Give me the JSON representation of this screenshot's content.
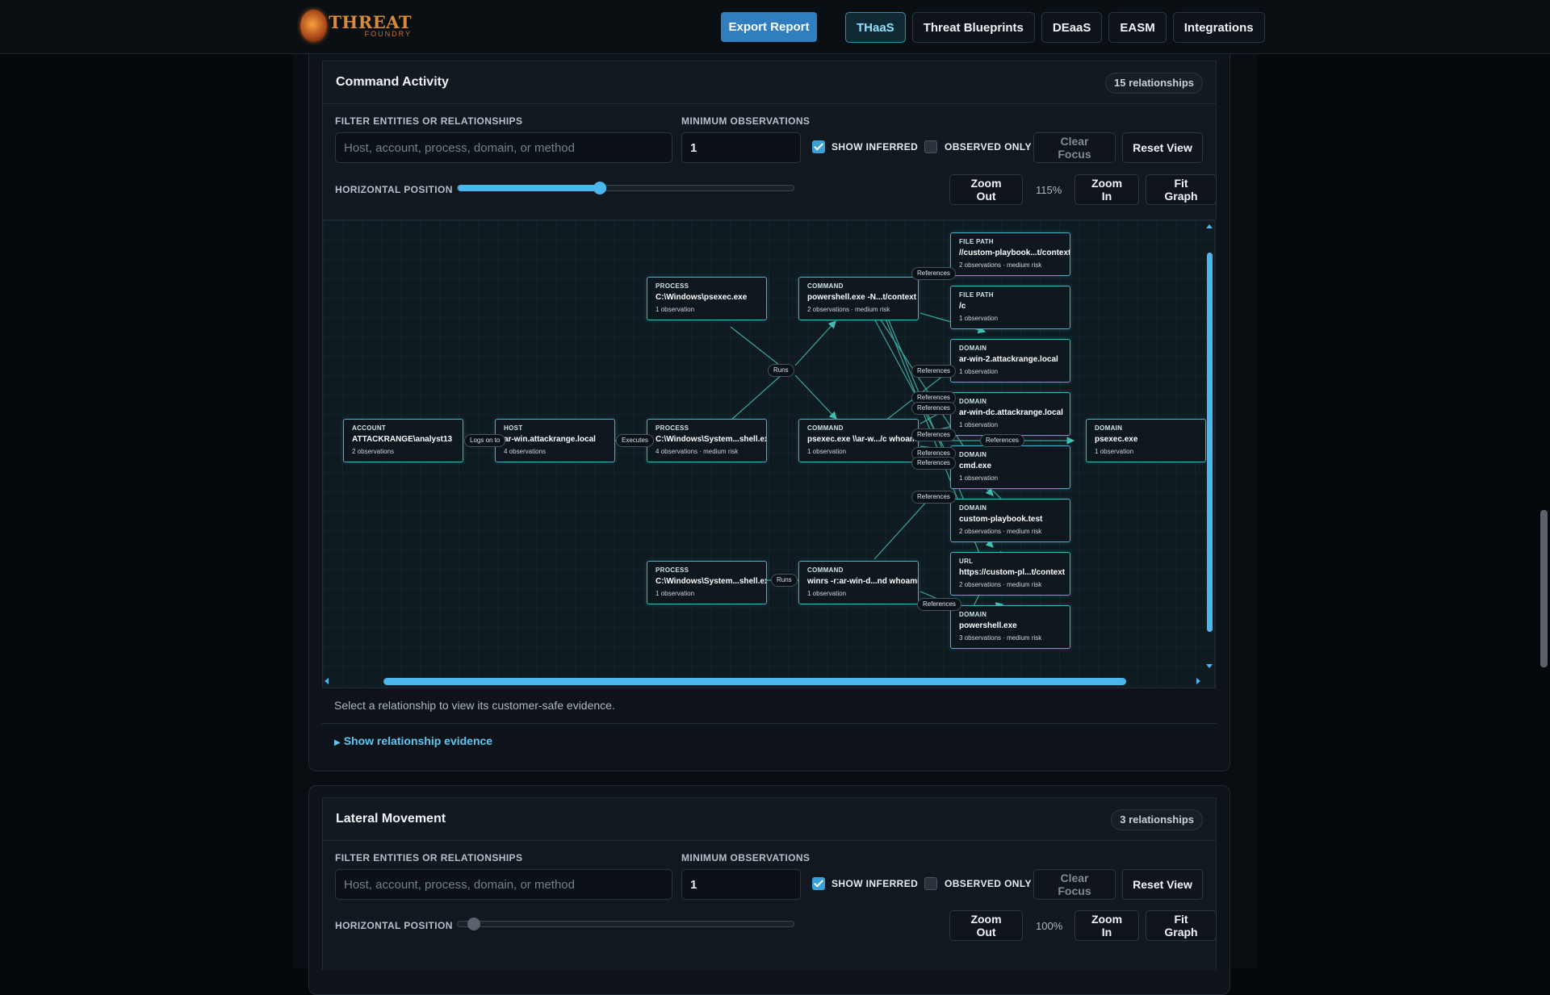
{
  "brand": {
    "line1": "THREAT",
    "line2": "FOUNDRY"
  },
  "header": {
    "export_label": "Export Report",
    "nav": [
      {
        "label": "THaaS",
        "active": true
      },
      {
        "label": "Threat Blueprints",
        "active": false
      },
      {
        "label": "DEaaS",
        "active": false
      },
      {
        "label": "EASM",
        "active": false
      },
      {
        "label": "Integrations",
        "active": false
      }
    ]
  },
  "panels": [
    {
      "title": "Command Activity",
      "badge": "15 relationships",
      "filter_label": "FILTER ENTITIES OR RELATIONSHIPS",
      "filter_placeholder": "Host, account, process, domain, or method",
      "min_obs_label": "MINIMUM OBSERVATIONS",
      "min_obs_value": "1",
      "show_inferred_label": "SHOW INFERRED",
      "show_inferred": true,
      "observed_only_label": "OBSERVED ONLY",
      "observed_only": false,
      "clear_focus": "Clear Focus",
      "reset_view": "Reset View",
      "hpos_label": "HORIZONTAL POSITION",
      "hpos_value": 0.42,
      "zoom_out": "Zoom Out",
      "zoom_pct": "115%",
      "zoom_in": "Zoom In",
      "fit_graph": "Fit Graph"
    },
    {
      "title": "Lateral Movement",
      "badge": "3 relationships",
      "filter_label": "FILTER ENTITIES OR RELATIONSHIPS",
      "filter_placeholder": "Host, account, process, domain, or method",
      "min_obs_label": "MINIMUM OBSERVATIONS",
      "min_obs_value": "1",
      "show_inferred_label": "SHOW INFERRED",
      "show_inferred": true,
      "observed_only_label": "OBSERVED ONLY",
      "observed_only": false,
      "clear_focus": "Clear Focus",
      "reset_view": "Reset View",
      "hpos_label": "HORIZONTAL POSITION",
      "hpos_value": 0.0,
      "zoom_out": "Zoom Out",
      "zoom_pct": "100%",
      "zoom_in": "Zoom In",
      "fit_graph": "Fit Graph"
    }
  ],
  "graph": {
    "nodes": [
      {
        "id": "acct",
        "type": "ACCOUNT",
        "name": "ATTACKRANGE\\analyst13",
        "meta": "2 observations"
      },
      {
        "id": "host",
        "type": "HOST",
        "name": "ar-win.attackrange.local",
        "meta": "4 observations"
      },
      {
        "id": "p1",
        "type": "PROCESS",
        "name": "C:\\Windows\\psexec.exe",
        "meta": "1 observation"
      },
      {
        "id": "p2",
        "type": "PROCESS",
        "name": "C:\\Windows\\System...shell.exe",
        "meta": "4 observations · medium risk"
      },
      {
        "id": "p3",
        "type": "PROCESS",
        "name": "C:\\Windows\\System...shell.exe",
        "meta": "1 observation"
      },
      {
        "id": "c1",
        "type": "COMMAND",
        "name": "powershell.exe -N...t/context",
        "meta": "2 observations · medium risk"
      },
      {
        "id": "c2",
        "type": "COMMAND",
        "name": "psexec.exe \\\\ar-w.../c whoami",
        "meta": "1 observation"
      },
      {
        "id": "c3",
        "type": "COMMAND",
        "name": "winrs -r:ar-win-d...nd whoami",
        "meta": "1 observation"
      },
      {
        "id": "f1",
        "type": "FILE PATH",
        "name": "//custom-playbook...t/context",
        "meta": "2 observations · medium risk"
      },
      {
        "id": "f2",
        "type": "FILE PATH",
        "name": "/c",
        "meta": "1 observation"
      },
      {
        "id": "d1",
        "type": "DOMAIN",
        "name": "ar-win-2.attackrange.local",
        "meta": "1 observation"
      },
      {
        "id": "d2",
        "type": "DOMAIN",
        "name": "ar-win-dc.attackrange.local",
        "meta": "1 observation"
      },
      {
        "id": "d3",
        "type": "DOMAIN",
        "name": "cmd.exe",
        "meta": "1 observation"
      },
      {
        "id": "d4",
        "type": "DOMAIN",
        "name": "custom-playbook.test",
        "meta": "2 observations · medium risk"
      },
      {
        "id": "u1",
        "type": "URL",
        "name": "https://custom-pl...t/context",
        "meta": "2 observations · medium risk"
      },
      {
        "id": "d5",
        "type": "DOMAIN",
        "name": "powershell.exe",
        "meta": "3 observations · medium risk"
      },
      {
        "id": "d6",
        "type": "DOMAIN",
        "name": "psexec.exe",
        "meta": "1 observation"
      }
    ],
    "edge_labels": {
      "logs_on_to": "Logs on to",
      "executes": "Executes",
      "runs": "Runs",
      "references": "References"
    }
  },
  "hint": "Select a relationship to view its customer-safe evidence.",
  "evidence_toggle": "Show relationship evidence"
}
